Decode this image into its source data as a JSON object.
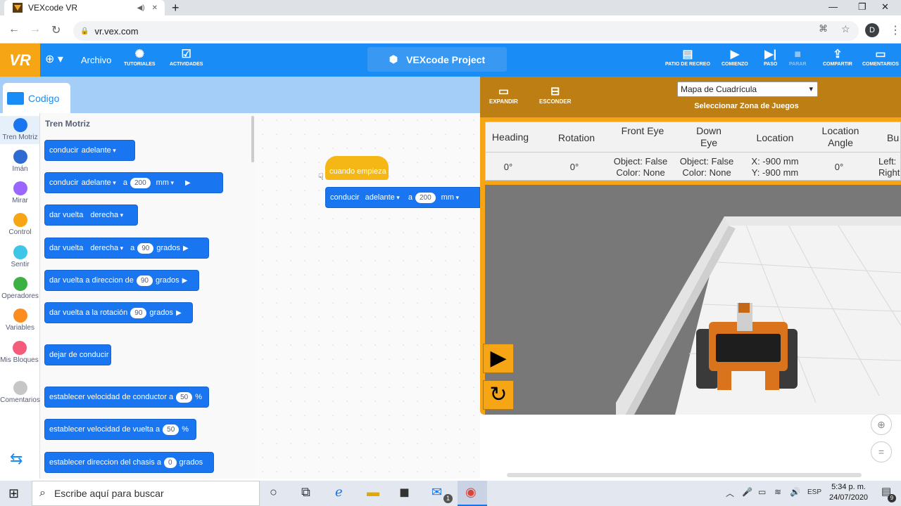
{
  "browser": {
    "tab_title": "VEXcode VR",
    "url": "vr.vex.com",
    "avatar_letter": "D"
  },
  "vex": {
    "logo": "VR",
    "archivo": "Archivo",
    "tutoriales": "TUTORIALES",
    "actividades": "ACTIVIDADES",
    "project": "VEXcode Project",
    "right": [
      "PATIO DE RECREO",
      "COMIENZO",
      "PASO",
      "PARAR",
      "COMPARTIR",
      "COMENTARIOS"
    ]
  },
  "code_tab": "Codigo",
  "categories": [
    {
      "label": "Tren Motriz",
      "color": "#1a75f0"
    },
    {
      "label": "Imán",
      "color": "#2f6bd1"
    },
    {
      "label": "Mirar",
      "color": "#9966ff"
    },
    {
      "label": "Control",
      "color": "#f6a515"
    },
    {
      "label": "Sentir",
      "color": "#3ec6e8"
    },
    {
      "label": "Operadores",
      "color": "#3cb043"
    },
    {
      "label": "Variables",
      "color": "#fd8c1e"
    },
    {
      "label": "Mis Bloques",
      "color": "#f55b7a"
    },
    {
      "label": "Comentarios",
      "color": "#c6c6c6"
    }
  ],
  "palette_title": "Tren Motriz",
  "blocks": {
    "b1": {
      "a": "conducir",
      "dd": "adelante"
    },
    "b2": {
      "a": "conducir",
      "dd": "adelante",
      "a2": "a",
      "val": "200",
      "unit": "mm"
    },
    "b3": {
      "a": "dar vuelta",
      "dd": "derecha"
    },
    "b4": {
      "a": "dar vuelta",
      "dd": "derecha",
      "a2": "a",
      "val": "90",
      "unit": "grados"
    },
    "b5": {
      "a": "dar vuelta a direccion de",
      "val": "90",
      "unit": "grados"
    },
    "b6": {
      "a": "dar vuelta a la rotación",
      "val": "90",
      "unit": "grados"
    },
    "b7": {
      "a": "dejar de conducir"
    },
    "b8": {
      "a": "establecer velocidad de conductor a",
      "val": "50",
      "unit": "%"
    },
    "b9": {
      "a": "establecer velocidad de vuelta a",
      "val": "50",
      "unit": "%"
    },
    "b10": {
      "a": "establecer direccion del chasis a",
      "val": "0",
      "unit": "grados"
    }
  },
  "script": {
    "hat": "cuando empieza",
    "a": "conducir",
    "dd": "adelante",
    "a2": "a",
    "val": "200",
    "unit": "mm"
  },
  "playground": {
    "expand": "EXPANDIR",
    "hide": "ESCONDER",
    "map": "Mapa de Cuadrícula",
    "map_caption": "Seleccionar Zona de Juegos",
    "headers": [
      "Heading",
      "Rotation",
      "Front Eye",
      "Down Eye",
      "Location",
      "Location Angle",
      "Bu"
    ],
    "values": {
      "heading": "0°",
      "rotation": "0°",
      "front_eye": [
        "Object: False",
        "Color: None"
      ],
      "down_eye": [
        "Object: False",
        "Color: None"
      ],
      "location": [
        "X: -900 mm",
        "Y: -900 mm"
      ],
      "location_angle": "0°",
      "bumper": [
        "Left:",
        "Right"
      ]
    }
  },
  "taskbar": {
    "search": "Escribe aquí para buscar",
    "time": "5:34 p. m.",
    "date": "24/07/2020",
    "lang": "ESP",
    "mail_badge": "1",
    "notif": "9"
  }
}
